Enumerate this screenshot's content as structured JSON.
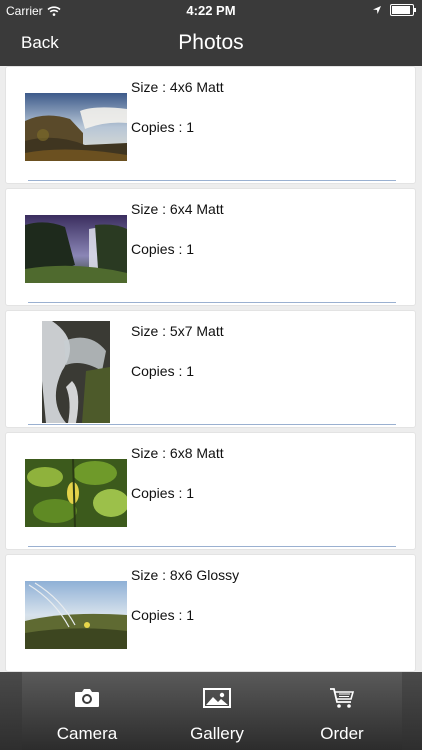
{
  "status_bar": {
    "carrier": "Carrier",
    "time": "4:22 PM"
  },
  "nav": {
    "back_label": "Back",
    "title": "Photos"
  },
  "photos": [
    {
      "size": "Size : 4x6 Matt",
      "copies": "Copies : 1",
      "subject": "waterfall-coast"
    },
    {
      "size": "Size : 6x4 Matt",
      "copies": "Copies : 1",
      "subject": "waterfall-valley"
    },
    {
      "size": "Size : 5x7 Matt",
      "copies": "Copies : 1",
      "subject": "waterfall-stream"
    },
    {
      "size": "Size : 6x8 Matt",
      "copies": "Copies : 1",
      "subject": "leaves"
    },
    {
      "size": "Size : 8x6 Glossy",
      "copies": "Copies : 1",
      "subject": "grass-sky"
    }
  ],
  "tabs": [
    {
      "label": "Camera",
      "icon": "camera-icon"
    },
    {
      "label": "Gallery",
      "icon": "image-icon"
    },
    {
      "label": "Order",
      "icon": "cart-icon"
    }
  ],
  "colors": {
    "bar": "#3a3a3a",
    "separator": "#9ab0d0"
  }
}
